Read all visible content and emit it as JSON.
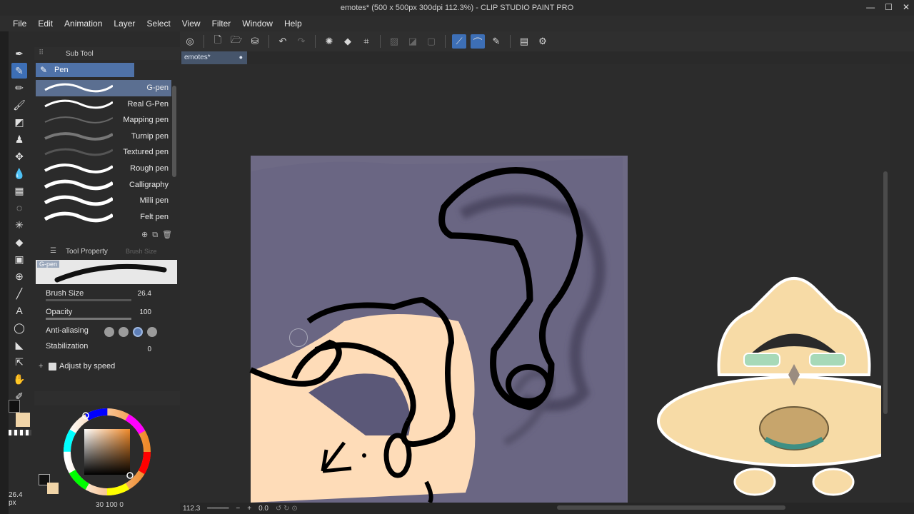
{
  "window": {
    "title": "emotes* (500 x 500px 300dpi 112.3%) - CLIP STUDIO PAINT PRO",
    "minimize": "—",
    "maximize": "☐",
    "close": "✕"
  },
  "menu": [
    "File",
    "Edit",
    "Animation",
    "Layer",
    "Select",
    "View",
    "Filter",
    "Window",
    "Help"
  ],
  "document_tab": {
    "label": "emotes*",
    "close": "●"
  },
  "sub_tool": {
    "header": "Sub Tool",
    "group": "Pen",
    "brushes": [
      {
        "name": "G-pen",
        "selected": true
      },
      {
        "name": "Real G-Pen",
        "selected": false
      },
      {
        "name": "Mapping pen",
        "selected": false
      },
      {
        "name": "Turnip pen",
        "selected": false
      },
      {
        "name": "Textured pen",
        "selected": false
      },
      {
        "name": "Rough pen",
        "selected": false
      },
      {
        "name": "Calligraphy",
        "selected": false
      },
      {
        "name": "Milli pen",
        "selected": false
      },
      {
        "name": "Felt pen",
        "selected": false
      }
    ]
  },
  "tool_property": {
    "header": "Tool Property",
    "tab2": "Brush Size",
    "preview_label": "G-pen",
    "brush_size_label": "Brush Size",
    "brush_size_value": "26.4",
    "opacity_label": "Opacity",
    "opacity_value": "100",
    "antialias_label": "Anti-aliasing",
    "stabilization_label": "Stabilization",
    "stabilization_value": "0",
    "adjust_label": "Adjust by speed"
  },
  "color": {
    "main": "#1a1a1a",
    "sub": "#f1d5a8",
    "hsv_values": "30  100  0"
  },
  "brush_size_readout": {
    "value": "26.4",
    "unit": "px"
  },
  "status": {
    "zoom": "112.3",
    "angle": "0.0"
  },
  "colors": {
    "accent": "#3d6fb6",
    "canvas_bg": "#6e6a85",
    "skin": "#fedcb8"
  }
}
